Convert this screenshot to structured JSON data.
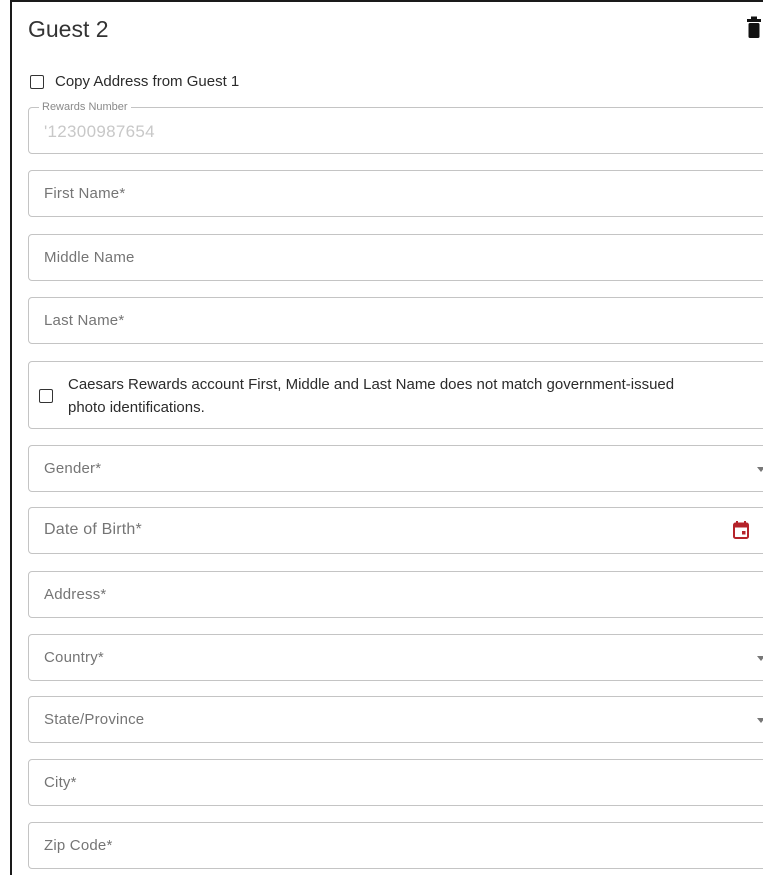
{
  "guest": {
    "title": "Guest 2",
    "delete_icon": "trash-icon"
  },
  "copy_address": {
    "label": "Copy Address from Guest 1",
    "checked": false
  },
  "rewards": {
    "legend": "Rewards Number",
    "value": "'12300987654"
  },
  "fields": {
    "first_name": "First Name*",
    "middle_name": "Middle Name",
    "last_name": "Last Name*",
    "gender": "Gender*",
    "dob": "Date of Birth*",
    "address": "Address*",
    "country": "Country*",
    "state": "State/Province",
    "city": "City*",
    "zip": "Zip Code*"
  },
  "name_mismatch": {
    "label": "Caesars Rewards account First, Middle and Last Name does not match government-issued photo identifications.",
    "checked": false
  },
  "icons": {
    "calendar": "calendar-icon",
    "dropdown": "caret-down-icon"
  },
  "colors": {
    "calendar_accent": "#b5232a",
    "border": "#c4c4c4",
    "placeholder": "#757575"
  }
}
